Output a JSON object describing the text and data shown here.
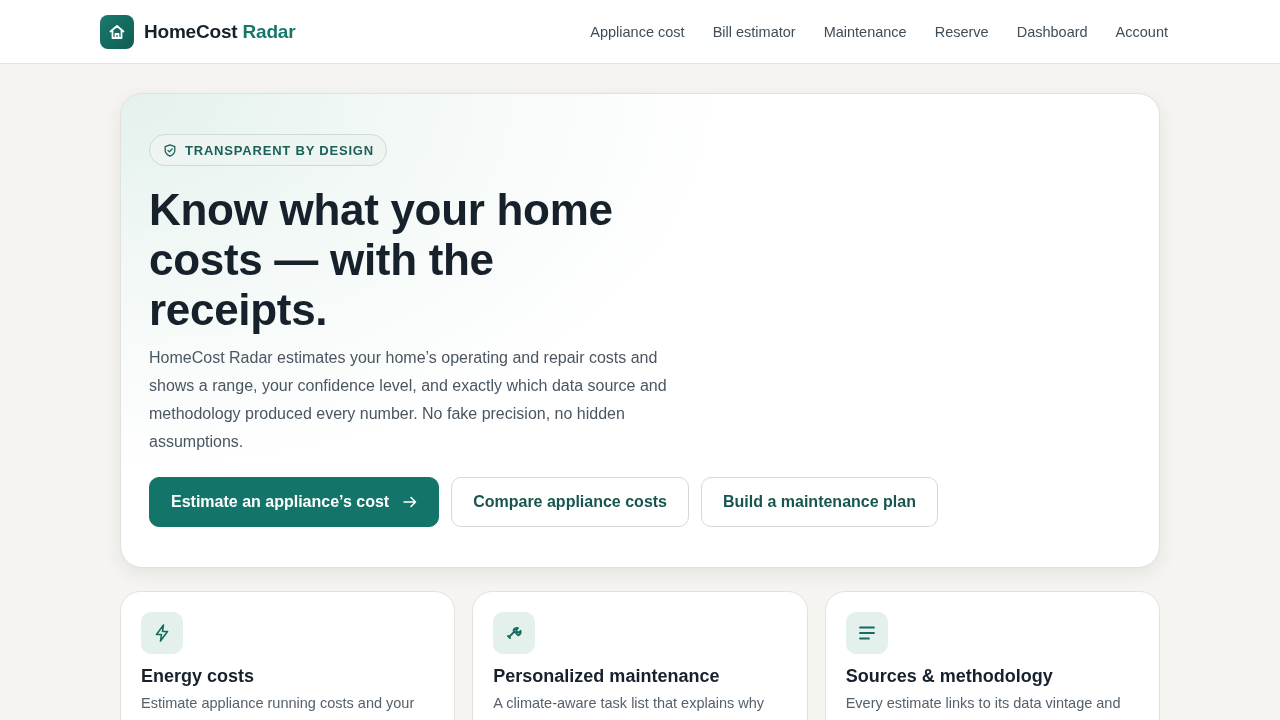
{
  "header": {
    "brand": {
      "name": "HomeCost",
      "accent": "Radar"
    },
    "nav": [
      {
        "label": "Appliance cost"
      },
      {
        "label": "Bill estimator"
      },
      {
        "label": "Maintenance"
      },
      {
        "label": "Reserve"
      },
      {
        "label": "Dashboard"
      },
      {
        "label": "Account"
      }
    ]
  },
  "hero": {
    "badge": "TRANSPARENT BY DESIGN",
    "title": "Know what your home costs — with the receipts.",
    "description": "HomeCost Radar estimates your home’s operating and repair costs and shows a range, your confidence level, and exactly which data source and methodology produced every number. No fake precision, no hidden assumptions.",
    "buttons": [
      {
        "label": "Estimate an appliance’s cost",
        "kind": "primary"
      },
      {
        "label": "Compare appliance costs",
        "kind": "secondary"
      },
      {
        "label": "Build a maintenance plan",
        "kind": "secondary"
      }
    ]
  },
  "features": [
    {
      "title": "Energy costs",
      "description": "Estimate appliance running costs and your"
    },
    {
      "title": "Personalized maintenance",
      "description": "A climate-aware task list that explains why"
    },
    {
      "title": "Sources & methodology",
      "description": "Every estimate links to its data vintage and"
    }
  ]
}
